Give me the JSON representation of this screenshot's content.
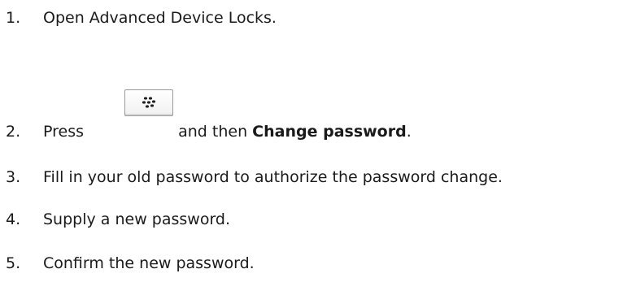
{
  "steps": [
    {
      "number": "1.",
      "text": "Open Advanced Device Locks."
    },
    {
      "number": "2.",
      "text_before": "Press",
      "icon": "blackberry-menu-key-icon",
      "text_middle": "and then",
      "text_bold": "Change password",
      "text_after": "."
    },
    {
      "number": "3.",
      "text": "Fill in your old password to authorize the password change."
    },
    {
      "number": "4.",
      "text": "Supply a new password."
    },
    {
      "number": "5.",
      "text": "Confirm the new password."
    }
  ]
}
